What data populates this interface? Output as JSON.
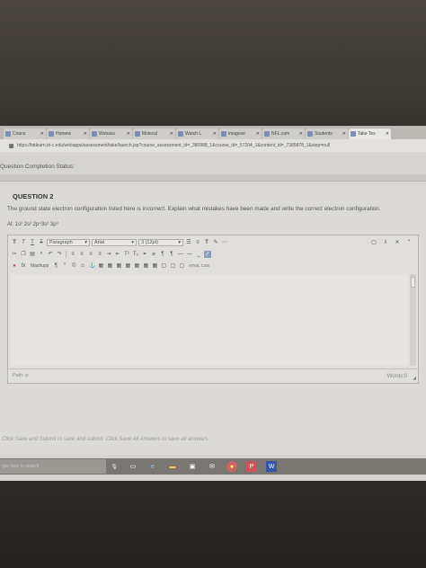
{
  "browser": {
    "tabs": [
      {
        "label": "Coursi"
      },
      {
        "label": "Homew"
      },
      {
        "label": "Webass"
      },
      {
        "label": "Molecul"
      },
      {
        "label": "Watch L"
      },
      {
        "label": "imagese"
      },
      {
        "label": "NFL.com"
      },
      {
        "label": "Students"
      },
      {
        "label": "Take Tes",
        "active": true
      }
    ],
    "url": "https://bblearn.tri-c.edu/webapps/assessment/take/launch.jsp?course_assessment_id=_380988_1&course_id=_57204_1&content_id=_7385878_1&step=null"
  },
  "page": {
    "status_label": "Question Completion Status:",
    "question": {
      "title": "QUESTION 2",
      "text": "The ground state electron configuration listed here is incorrect. Explain what mistakes have been made and write the correct electron configuration.",
      "configuration": "Al: 1s² 2s² 2p⁴3s² 3p³"
    },
    "editor": {
      "format_tt": "T T T T",
      "paragraph": "Paragraph",
      "font": "Arial",
      "size": "3 (12pt)",
      "mashups": "Mashups",
      "html": "HTML CSS",
      "path": "Path: p",
      "words": "Words:0"
    },
    "submit_note": "Click Save and Submit to save and submit. Click Save All Answers to save all answers."
  },
  "taskbar": {
    "search_placeholder": "ype here to search"
  },
  "colors": {
    "screen_bg": "#d6d4d0",
    "taskbar": "#7a7672",
    "tab_icon": "#7b8fb3"
  }
}
